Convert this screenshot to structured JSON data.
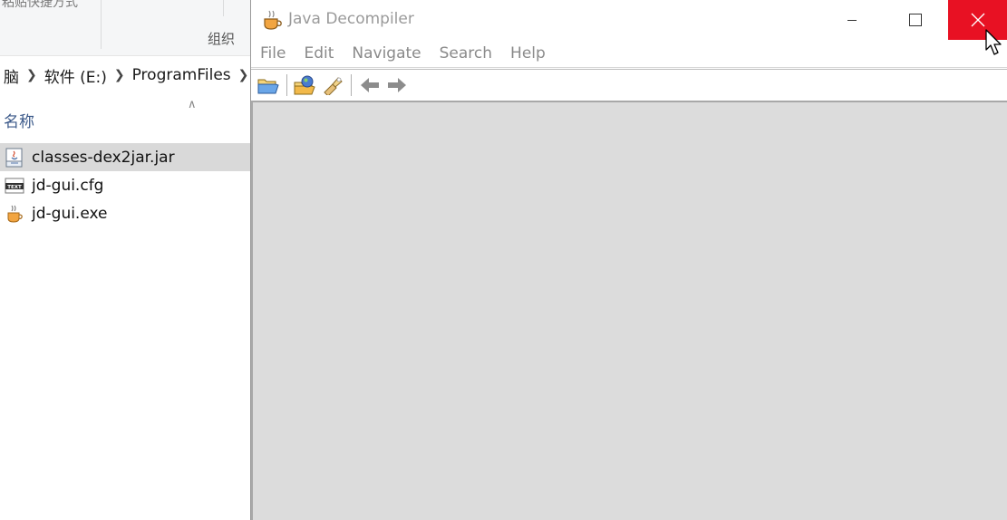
{
  "explorer": {
    "ribbon": {
      "cut_text": "粘贴快捷方式",
      "group_label": "组织"
    },
    "breadcrumb": [
      {
        "label": "脑"
      },
      {
        "label": "软件 (E:)"
      },
      {
        "label": "ProgramFiles"
      }
    ],
    "column_header": {
      "name": "名称"
    },
    "files": [
      {
        "name": "classes-dex2jar.jar",
        "icon": "jar-file-icon",
        "selected": true
      },
      {
        "name": "jd-gui.cfg",
        "icon": "text-file-icon",
        "selected": false
      },
      {
        "name": "jd-gui.exe",
        "icon": "java-exe-icon",
        "selected": false
      }
    ]
  },
  "jd": {
    "title": "Java Decompiler",
    "menu": [
      "File",
      "Edit",
      "Navigate",
      "Search",
      "Help"
    ],
    "toolbar": {
      "icons": [
        "open-folder-icon",
        "open-type-icon",
        "search-flashlight-icon",
        "back-arrow-icon",
        "forward-arrow-icon"
      ]
    },
    "window_controls": [
      "minimize",
      "maximize",
      "close"
    ],
    "colors": {
      "close_hover": "#e81123",
      "content_bg": "#dcdcdc"
    }
  }
}
